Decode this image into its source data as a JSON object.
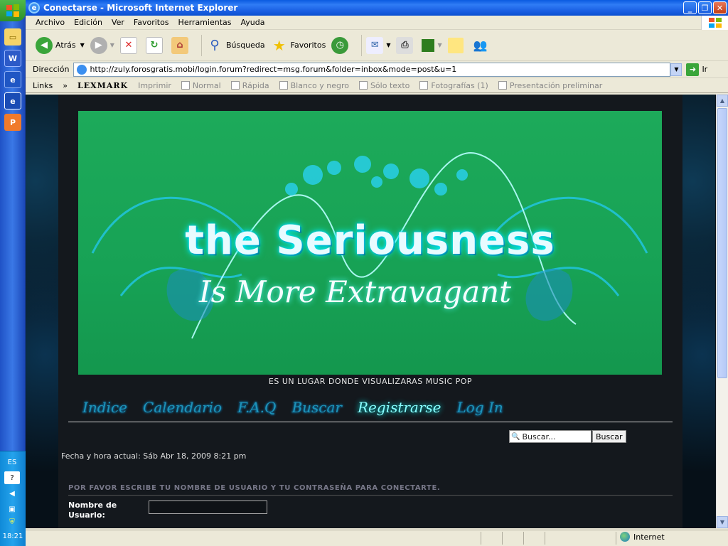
{
  "window": {
    "title": "Conectarse - Microsoft Internet Explorer"
  },
  "menu": [
    "Archivo",
    "Edición",
    "Ver",
    "Favoritos",
    "Herramientas",
    "Ayuda"
  ],
  "toolbar": {
    "back": "Atrás",
    "search": "Búsqueda",
    "favorites": "Favoritos"
  },
  "address": {
    "label": "Dirección",
    "url": "http://zuly.forosgratis.mobi/login.forum?redirect=msg.forum&folder=inbox&mode=post&u=1",
    "go": "Ir"
  },
  "links": {
    "label": "Links",
    "items": [
      "LEXMARK",
      "Imprimir",
      "Normal",
      "Rápida",
      "Blanco y negro",
      "Sólo texto",
      "Fotografías (1)",
      "Presentación preliminar"
    ]
  },
  "banner": {
    "title": "the Seriousness",
    "subtitle": "Is More Extravagant"
  },
  "tagline": "ES UN LUGAR DONDE VISUALIZARAS MUSIC POP",
  "nav": [
    "Indice",
    "Calendario",
    "F.A.Q",
    "Buscar",
    "Registrarse",
    "Log In"
  ],
  "search": {
    "placeholder": "Buscar...",
    "button": "Buscar"
  },
  "datetime": "Fecha y hora actual: Sáb Abr 18, 2009 8:21 pm",
  "login": {
    "heading": "POR FAVOR ESCRIBE TU NOMBRE DE USUARIO Y TU CONTRASEÑA PARA CONECTARTE.",
    "username_label": "Nombre de Usuario:"
  },
  "status": {
    "zone": "Internet"
  },
  "taskbar": {
    "lang": "ES",
    "clock": "18:21"
  }
}
